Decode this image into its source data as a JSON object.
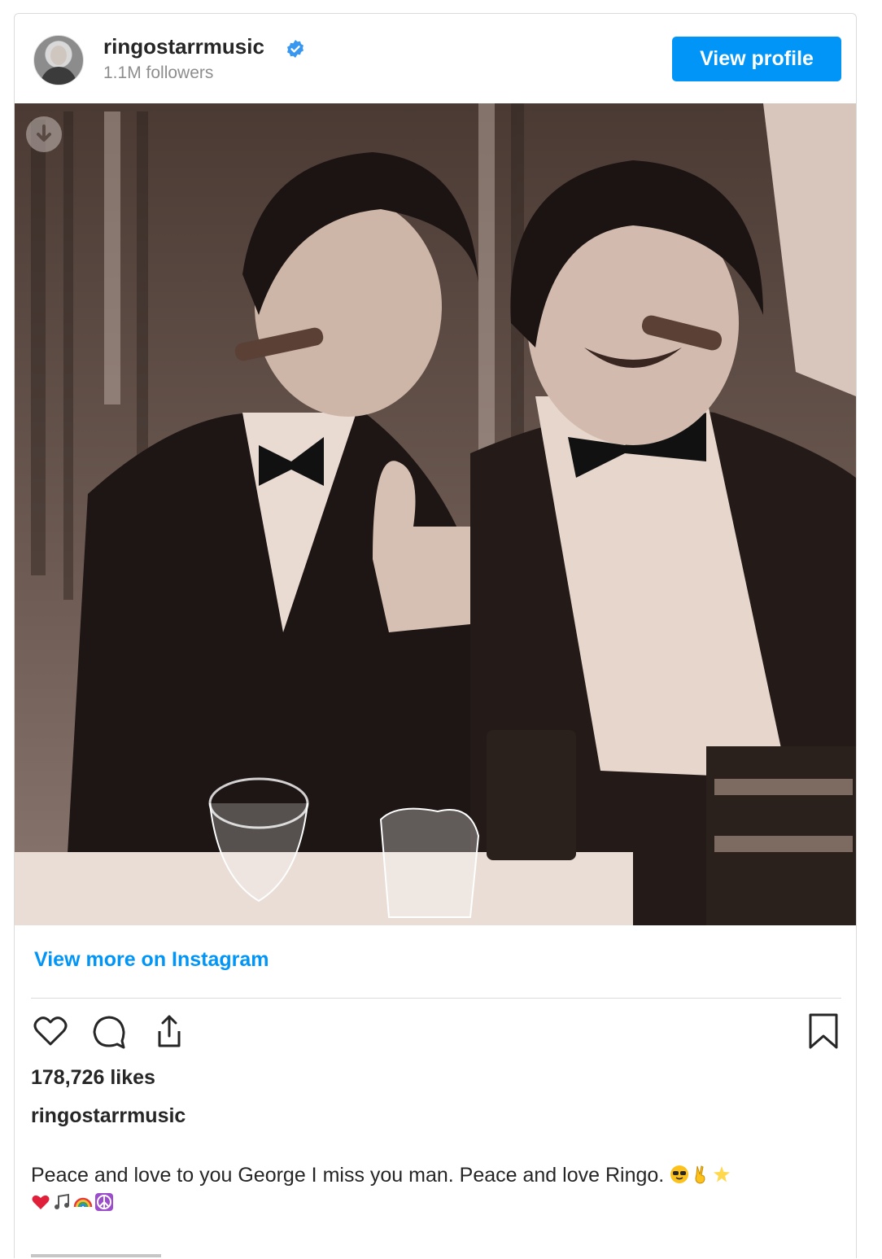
{
  "header": {
    "username": "ringostarrmusic",
    "verified": true,
    "followers": "1.1M followers",
    "view_profile_label": "View profile"
  },
  "post": {
    "view_more_label": "View more on Instagram",
    "likes": "178,726 likes",
    "caption_username": "ringostarrmusic",
    "caption_text": "Peace and love to you George I miss you man. Peace and love Ringo.",
    "caption_emojis": [
      "sunglasses-face",
      "victory-hand",
      "glowing-star",
      "red-heart",
      "musical-notes",
      "rainbow",
      "peace-symbol"
    ]
  },
  "actions": {
    "like_icon": "heart-icon",
    "comment_icon": "comment-icon",
    "share_icon": "share-icon",
    "save_icon": "bookmark-icon"
  },
  "colors": {
    "accent": "#0095f6",
    "text": "#262626",
    "muted": "#8e8e8e",
    "border": "#dbdbdb"
  }
}
